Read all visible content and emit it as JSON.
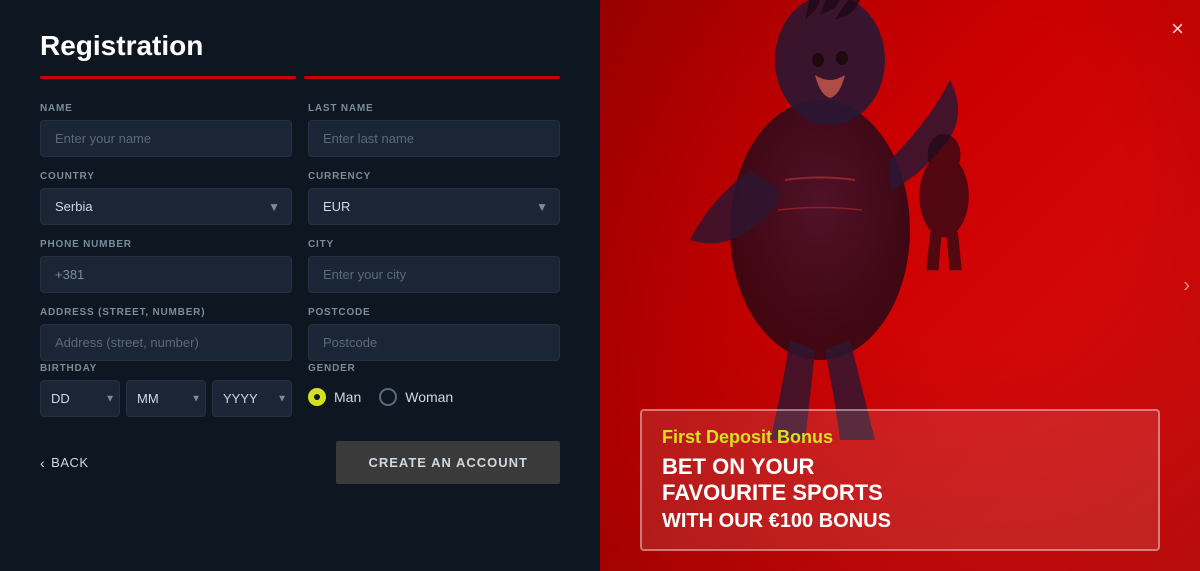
{
  "page": {
    "title": "Registration"
  },
  "progress": {
    "segments": [
      {
        "key": "seg1",
        "state": "active"
      },
      {
        "key": "seg2",
        "state": "active"
      }
    ]
  },
  "form": {
    "name_label": "NAME",
    "name_placeholder": "Enter your name",
    "lastname_label": "LAST NAME",
    "lastname_placeholder": "Enter last name",
    "country_label": "COUNTRY",
    "country_value": "Serbia",
    "currency_label": "CURRENCY",
    "currency_value": "EUR",
    "phone_label": "PHONE NUMBER",
    "phone_value": "+381",
    "city_label": "CITY",
    "city_placeholder": "Enter your city",
    "address_label": "ADDRESS (STREET, NUMBER)",
    "address_placeholder": "Address (street, number)",
    "postcode_label": "POSTCODE",
    "postcode_placeholder": "Postcode",
    "birthday_label": "BIRTHDAY",
    "birthday_dd": "DD",
    "birthday_mm": "MM",
    "birthday_yyyy": "YYYY",
    "gender_label": "GENDER",
    "gender_man_label": "Man",
    "gender_woman_label": "Woman"
  },
  "buttons": {
    "back_label": "BACK",
    "create_account_label": "CREATE AN ACCOUNT",
    "close_label": "×"
  },
  "bonus": {
    "title": "First Deposit Bonus",
    "line1": "BET ON YOUR",
    "line2": "FAVOURITE SPORTS",
    "line3": "WITH OUR €100 BONUS"
  },
  "icons": {
    "chevron_down": "▼",
    "back_arrow": "‹",
    "close": "×",
    "right_arrow": "›"
  }
}
